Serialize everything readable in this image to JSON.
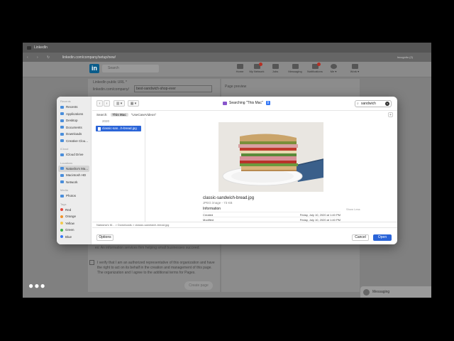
{
  "browser": {
    "tab_title": "LinkedIn",
    "url": "linkedin.com/company/setup/new/",
    "account": "Incognito (2)"
  },
  "linkedin": {
    "search_placeholder": "Search",
    "nav": [
      {
        "label": "Home"
      },
      {
        "label": "My Network",
        "badge": true
      },
      {
        "label": "Jobs"
      },
      {
        "label": "Messaging"
      },
      {
        "label": "Notifications",
        "badge": true
      },
      {
        "label": "Me ▾"
      },
      {
        "label": "Work ▾"
      }
    ],
    "public_url_label": "LinkedIn public URL *",
    "public_url_prefix": "linkedin.com/company/",
    "public_url_value": "best-sandwich-shop-ever",
    "page_preview_label": "Page preview",
    "tagline_placeholder": "ex: An information services firm helping small businesses succeed.",
    "verify_text_1": "I verify that I am an authorized representative of this organization and have",
    "verify_text_2": "the right to act on its behalf in the creation and management of this page.",
    "verify_text_3": "The organization and I agree to the additional terms for Pages.",
    "create_button": "Create page",
    "messaging_label": "Messaging"
  },
  "dialog": {
    "location_title": "Searching \"This Mac\"",
    "search_value": "sandwich",
    "scope": {
      "search_label": "Search:",
      "this_mac": "This Mac",
      "other": "\"UseCaseVideos\""
    },
    "sidebar": {
      "sections": [
        {
          "title": "Recents",
          "items": [
            {
              "label": "Recents",
              "icon": "clock-icon"
            },
            {
              "label": "Applications",
              "icon": "apps-icon"
            },
            {
              "label": "Desktop",
              "icon": "desktop-icon"
            },
            {
              "label": "Documents",
              "icon": "document-icon"
            },
            {
              "label": "Downloads",
              "icon": "download-icon"
            },
            {
              "label": "Creative Clou...",
              "icon": "folder-icon"
            }
          ]
        },
        {
          "title": "iCloud",
          "items": [
            {
              "label": "iCloud Drive",
              "icon": "cloud-icon"
            }
          ]
        },
        {
          "title": "Locations",
          "items": [
            {
              "label": "Natasha's Ma...",
              "icon": "computer-icon",
              "selected": true
            },
            {
              "label": "Macintosh HD",
              "icon": "disk-icon"
            },
            {
              "label": "Network",
              "icon": "network-icon"
            }
          ]
        },
        {
          "title": "Media",
          "items": [
            {
              "label": "Photos",
              "icon": "photos-icon"
            }
          ]
        }
      ],
      "tags_title": "Tags",
      "tags": [
        {
          "label": "Red",
          "color": "#e5443a"
        },
        {
          "label": "Orange",
          "color": "#f0932b"
        },
        {
          "label": "Yellow",
          "color": "#f2c94c"
        },
        {
          "label": "Green",
          "color": "#3cb34a"
        },
        {
          "label": "Blue",
          "color": "#3478f6"
        }
      ]
    },
    "list_date_header": "2020",
    "selected_file": "classic-san...h-bread.jpg",
    "preview": {
      "file_name": "classic-sandwich-bread.jpg",
      "kind": "JPEG image - 73 KB",
      "info_header": "Information",
      "show_less": "Show Less",
      "rows": [
        {
          "label": "Created",
          "value": "Friday, July 10, 2020 at 1:40 PM"
        },
        {
          "label": "Modified",
          "value": "Friday, July 10, 2020 at 1:40 PM"
        }
      ]
    },
    "path": "Natasha's M... > Downloads > classic-sandwich-bread.jpg",
    "buttons": {
      "options": "Options",
      "cancel": "Cancel",
      "open": "Open"
    },
    "accent": "#2a64d8"
  }
}
